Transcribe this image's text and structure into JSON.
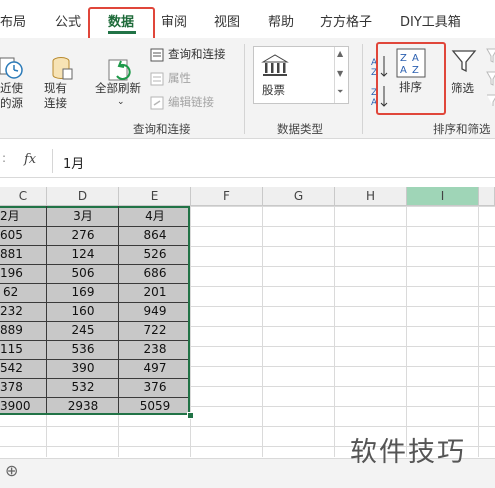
{
  "ribbon_tabs": [
    "布局",
    "公式",
    "数据",
    "审阅",
    "视图",
    "帮助",
    "方方格子",
    "DIY工具箱"
  ],
  "active_tab": "数据",
  "ribbon": {
    "recent_sources": [
      "近使",
      "的源"
    ],
    "existing_connections": [
      "现有",
      "连接"
    ],
    "refresh_all": "全部刷新",
    "queries_connections": "查询和连接",
    "properties": "属性",
    "edit_links": "编辑链接",
    "group_queries": "查询和连接",
    "stocks": "股票",
    "group_data_types": "数据类型",
    "sort": "排序",
    "filter": "筛选",
    "group_sort_filter": "排序和筛选"
  },
  "formula_bar": {
    "fx": "fx",
    "value": "1月"
  },
  "columns": [
    "C",
    "D",
    "E",
    "F",
    "G",
    "H",
    "I"
  ],
  "selected_column": "I",
  "table": {
    "headers": [
      "2月",
      "3月",
      "4月"
    ],
    "rows": [
      [
        "605",
        "276",
        "864"
      ],
      [
        "881",
        "124",
        "526"
      ],
      [
        "196",
        "506",
        "686"
      ],
      [
        "62",
        "169",
        "201"
      ],
      [
        "232",
        "160",
        "949"
      ],
      [
        "889",
        "245",
        "722"
      ],
      [
        "115",
        "536",
        "238"
      ],
      [
        "542",
        "390",
        "497"
      ],
      [
        "378",
        "532",
        "376"
      ],
      [
        "3900",
        "2938",
        "5059"
      ]
    ]
  },
  "sheet_add": "⊕",
  "watermark": "软件技巧",
  "colors": {
    "accent": "#217346",
    "highlight": "#e0463a",
    "selection_fill": "#c8c8c8",
    "selected_header": "#9fd5b7"
  }
}
